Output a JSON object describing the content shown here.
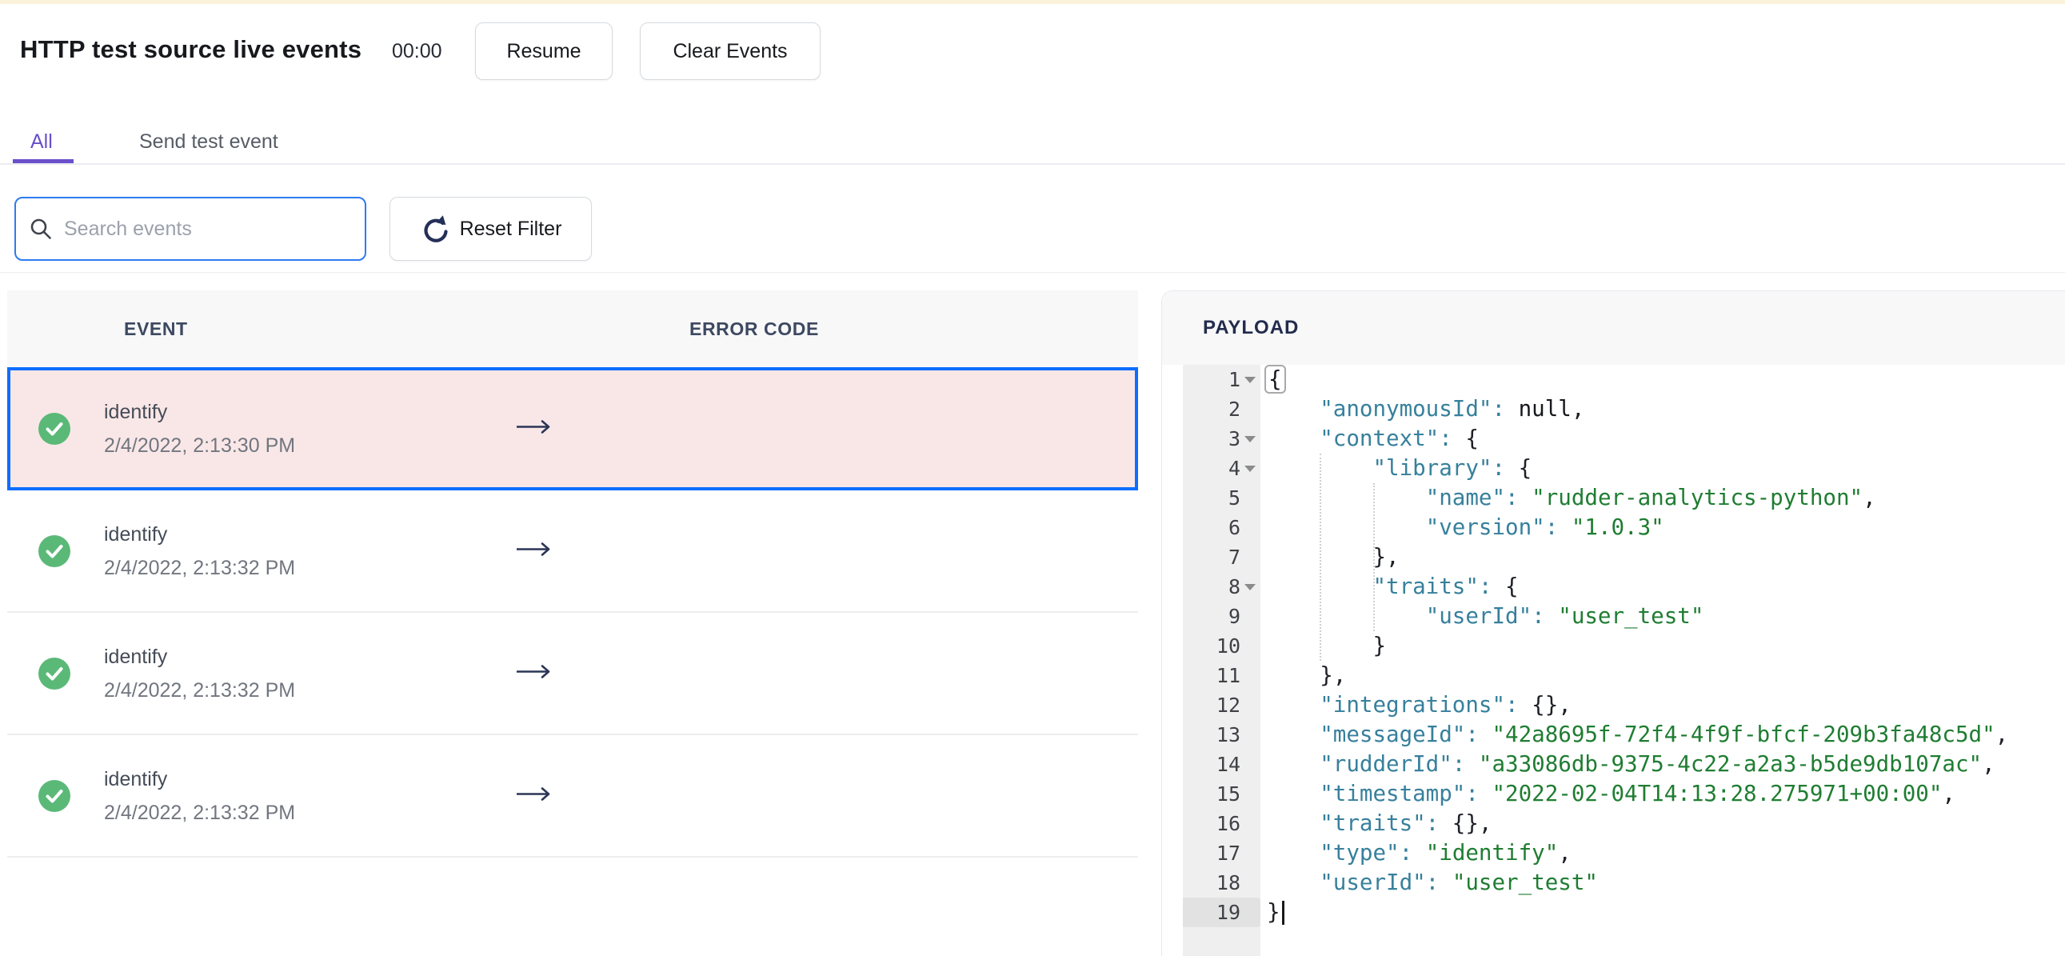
{
  "page": {
    "top_strip_color": "#fbf3d9"
  },
  "header": {
    "title": "HTTP test source live events",
    "timer": "00:00",
    "resume_label": "Resume",
    "clear_label": "Clear Events"
  },
  "tabs": {
    "all_label": "All",
    "send_label": "Send test event",
    "active": "All"
  },
  "filters": {
    "search_placeholder": "Search events",
    "search_value": "",
    "reset_label": "Reset Filter"
  },
  "events_table": {
    "columns": {
      "event": "EVENT",
      "error": "ERROR CODE"
    },
    "rows": [
      {
        "event": "identify",
        "time": "2/4/2022, 2:13:30 PM",
        "status": "success",
        "selected": true
      },
      {
        "event": "identify",
        "time": "2/4/2022, 2:13:32 PM",
        "status": "success",
        "selected": false
      },
      {
        "event": "identify",
        "time": "2/4/2022, 2:13:32 PM",
        "status": "success",
        "selected": false
      },
      {
        "event": "identify",
        "time": "2/4/2022, 2:13:32 PM",
        "status": "success",
        "selected": false
      }
    ]
  },
  "payload": {
    "title": "PAYLOAD",
    "active_line": 19,
    "cursor_line": 19,
    "fold_lines": [
      1,
      3,
      4,
      8
    ],
    "lines": [
      {
        "n": 1,
        "tokens": [
          [
            "b",
            "{"
          ]
        ]
      },
      {
        "n": 2,
        "tokens": [
          [
            "p",
            "    "
          ],
          [
            "k",
            "\"anonymousId\":"
          ],
          [
            "p",
            " "
          ],
          [
            "l",
            "null"
          ],
          [
            "p",
            ","
          ]
        ]
      },
      {
        "n": 3,
        "tokens": [
          [
            "p",
            "    "
          ],
          [
            "k",
            "\"context\":"
          ],
          [
            "p",
            " {"
          ]
        ]
      },
      {
        "n": 4,
        "tokens": [
          [
            "p",
            "        "
          ],
          [
            "k",
            "\"library\":"
          ],
          [
            "p",
            " {"
          ]
        ]
      },
      {
        "n": 5,
        "tokens": [
          [
            "p",
            "            "
          ],
          [
            "k",
            "\"name\":"
          ],
          [
            "p",
            " "
          ],
          [
            "s",
            "\"rudder-analytics-python\""
          ],
          [
            "p",
            ","
          ]
        ]
      },
      {
        "n": 6,
        "tokens": [
          [
            "p",
            "            "
          ],
          [
            "k",
            "\"version\":"
          ],
          [
            "p",
            " "
          ],
          [
            "s",
            "\"1.0.3\""
          ]
        ]
      },
      {
        "n": 7,
        "tokens": [
          [
            "p",
            "        },"
          ]
        ]
      },
      {
        "n": 8,
        "tokens": [
          [
            "p",
            "        "
          ],
          [
            "k",
            "\"traits\":"
          ],
          [
            "p",
            " {"
          ]
        ]
      },
      {
        "n": 9,
        "tokens": [
          [
            "p",
            "            "
          ],
          [
            "k",
            "\"userId\":"
          ],
          [
            "p",
            " "
          ],
          [
            "s",
            "\"user_test\""
          ]
        ]
      },
      {
        "n": 10,
        "tokens": [
          [
            "p",
            "        }"
          ]
        ]
      },
      {
        "n": 11,
        "tokens": [
          [
            "p",
            "    },"
          ]
        ]
      },
      {
        "n": 12,
        "tokens": [
          [
            "p",
            "    "
          ],
          [
            "k",
            "\"integrations\":"
          ],
          [
            "p",
            " {},"
          ]
        ]
      },
      {
        "n": 13,
        "tokens": [
          [
            "p",
            "    "
          ],
          [
            "k",
            "\"messageId\":"
          ],
          [
            "p",
            " "
          ],
          [
            "s",
            "\"42a8695f-72f4-4f9f-bfcf-209b3fa48c5d\""
          ],
          [
            "p",
            ","
          ]
        ]
      },
      {
        "n": 14,
        "tokens": [
          [
            "p",
            "    "
          ],
          [
            "k",
            "\"rudderId\":"
          ],
          [
            "p",
            " "
          ],
          [
            "s",
            "\"a33086db-9375-4c22-a2a3-b5de9db107ac\""
          ],
          [
            "p",
            ","
          ]
        ]
      },
      {
        "n": 15,
        "tokens": [
          [
            "p",
            "    "
          ],
          [
            "k",
            "\"timestamp\":"
          ],
          [
            "p",
            " "
          ],
          [
            "s",
            "\"2022-02-04T14:13:28.275971+00:00\""
          ],
          [
            "p",
            ","
          ]
        ]
      },
      {
        "n": 16,
        "tokens": [
          [
            "p",
            "    "
          ],
          [
            "k",
            "\"traits\":"
          ],
          [
            "p",
            " {},"
          ]
        ]
      },
      {
        "n": 17,
        "tokens": [
          [
            "p",
            "    "
          ],
          [
            "k",
            "\"type\":"
          ],
          [
            "p",
            " "
          ],
          [
            "s",
            "\"identify\""
          ],
          [
            "p",
            ","
          ]
        ]
      },
      {
        "n": 18,
        "tokens": [
          [
            "p",
            "    "
          ],
          [
            "k",
            "\"userId\":"
          ],
          [
            "p",
            " "
          ],
          [
            "s",
            "\"user_test\""
          ]
        ]
      },
      {
        "n": 19,
        "tokens": [
          [
            "p",
            "}"
          ]
        ]
      }
    ]
  },
  "colors": {
    "accent_purple": "#6a4fc9",
    "selected_row_border": "#0d6efd",
    "selected_row_bg": "#f9e7e7",
    "search_focus_border": "#2e7bf0",
    "success_green": "#5bb978",
    "header_navy": "#232c4e",
    "json_key": "#37809c",
    "json_string": "#1f7d32",
    "top_strip": "#fbf3d9"
  }
}
